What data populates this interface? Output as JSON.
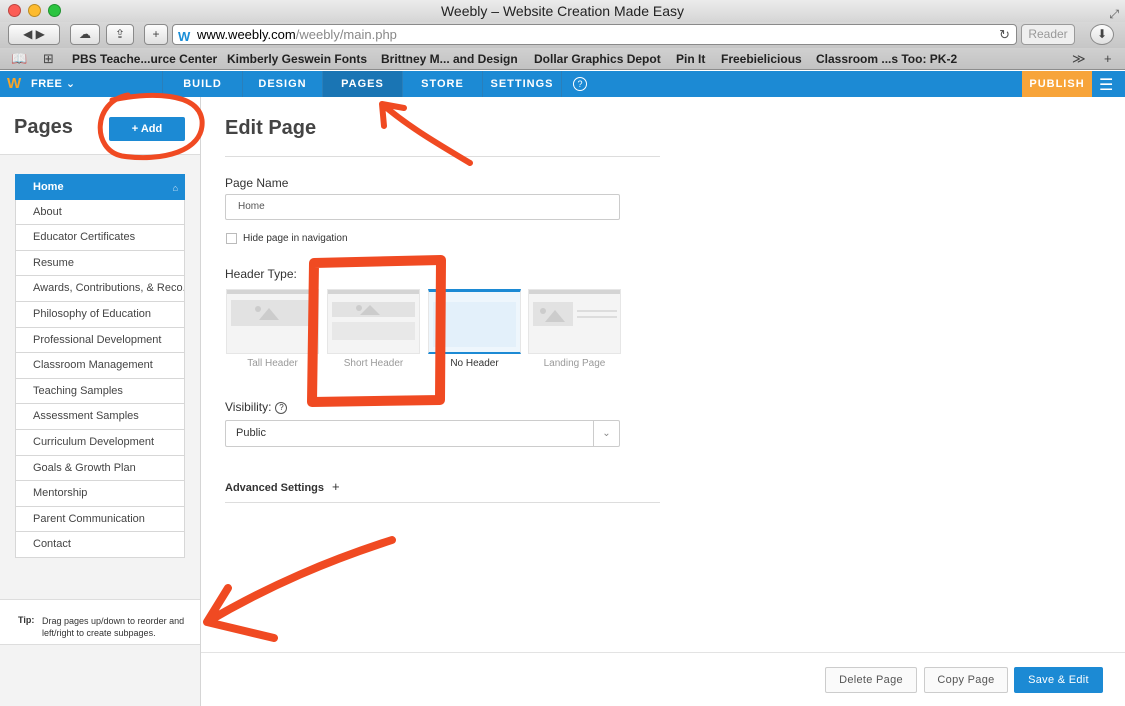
{
  "window": {
    "title": "Weebly – Website Creation Made Easy"
  },
  "browser": {
    "url_host": "www.weebly.com",
    "url_path": "/weebly/main.php",
    "reader_label": "Reader",
    "bookmarks": [
      "PBS Teache...urce Center",
      "Kimberly Geswein Fonts",
      "Brittney M... and Design",
      "Dollar Graphics Depot",
      "Pin It",
      "Freebielicious",
      "Classroom ...s Too: PK-2"
    ]
  },
  "topnav": {
    "plan": "FREE ⌄",
    "tabs": [
      "BUILD",
      "DESIGN",
      "PAGES",
      "STORE",
      "SETTINGS"
    ],
    "active_tab": "PAGES",
    "help": "?",
    "publish": "PUBLISH"
  },
  "sidebar": {
    "title": "Pages",
    "add_label": "+  Add",
    "pages": [
      "Home",
      "About",
      "Educator Certificates",
      "Resume",
      "Awards, Contributions, & Reco...",
      "Philosophy of Education",
      "Professional Development",
      "Classroom Management",
      "Teaching Samples",
      "Assessment Samples",
      "Curriculum Development",
      "Goals & Growth Plan",
      "Mentorship",
      "Parent Communication",
      "Contact"
    ],
    "tip_label": "Tip:",
    "tip_text": "Drag pages up/down to reorder and left/right to create subpages."
  },
  "editor": {
    "title": "Edit Page",
    "page_name_label": "Page Name",
    "page_name_value": "Home",
    "hide_nav_label": "Hide page in navigation",
    "header_type_label": "Header Type:",
    "header_types": [
      "Tall Header",
      "Short Header",
      "No Header",
      "Landing Page"
    ],
    "visibility_label": "Visibility:",
    "visibility_value": "Public",
    "advanced_label": "Advanced Settings",
    "advanced_plus": "+"
  },
  "footer": {
    "delete": "Delete Page",
    "copy": "Copy Page",
    "save": "Save & Edit"
  },
  "colors": {
    "accent": "#1c8ad4",
    "publish": "#f7a43a",
    "annotation": "#f04a22"
  }
}
